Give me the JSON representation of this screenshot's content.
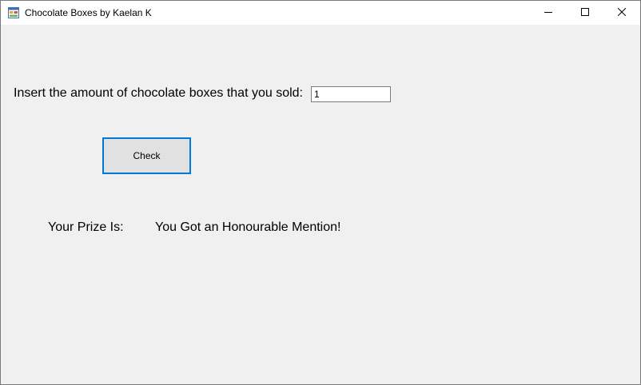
{
  "window": {
    "title": "Chocolate Boxes by Kaelan K",
    "icon": "winforms-app-icon",
    "controls": {
      "minimize_icon": "minimize-icon",
      "maximize_icon": "maximize-icon",
      "close_icon": "close-icon"
    }
  },
  "form": {
    "prompt_label": "Insert the amount of chocolate boxes that you sold:",
    "quantity_value": "1",
    "check_button_label": "Check",
    "prize_label": "Your Prize Is:",
    "prize_result": "You Got an Honourable Mention!"
  },
  "colors": {
    "form_background": "#f0f0f0",
    "titlebar_background": "#ffffff",
    "button_focus_border": "#0078d7",
    "button_face": "#e1e1e1"
  }
}
